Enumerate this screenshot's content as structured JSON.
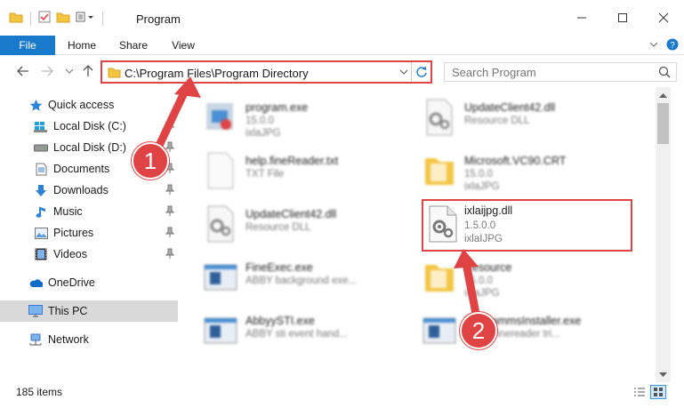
{
  "window": {
    "title": "Program"
  },
  "ribbon": {
    "file": "File",
    "home": "Home",
    "share": "Share",
    "view": "View"
  },
  "address": {
    "path": "C:\\Program Files\\Program Directory"
  },
  "search": {
    "placeholder": "Search Program"
  },
  "nav": {
    "quick_access": "Quick access",
    "local_c": "Local Disk (C:)",
    "local_d": "Local Disk (D:)",
    "documents": "Documents",
    "downloads": "Downloads",
    "music": "Music",
    "pictures": "Pictures",
    "videos": "Videos",
    "onedrive": "OneDrive",
    "this_pc": "This PC",
    "network": "Network"
  },
  "files": [
    {
      "name": "program.exe",
      "line2": "15.0.0",
      "line3": "ixlaJPG"
    },
    {
      "name": "UpdateClient42.dll",
      "line2": "Resource DLL",
      "line3": ""
    },
    {
      "name": "help.fineReader.txt",
      "line2": "TXT File",
      "line3": ""
    },
    {
      "name": "Microsoft.VC90.CRT",
      "line2": "15.0.0",
      "line3": "ixlaJPG"
    },
    {
      "name": "UpdateClient42.dll",
      "line2": "Resource DLL",
      "line3": ""
    },
    {
      "name": "FineExec.exe",
      "line2": "ABBY background exe...",
      "line3": ""
    },
    {
      "name": "Resource",
      "line2": "15.0.0",
      "line3": "ixlaJPG"
    },
    {
      "name": "AbbyySTI.exe",
      "line2": "ABBY sti event hand...",
      "line3": ""
    },
    {
      "name": "ProgrammsInstaller.exe",
      "line2": "ABBY finereader tri...",
      "line3": ""
    }
  ],
  "highlighted_file": {
    "name": "ixlaijpg.dll",
    "line2": "1.5.0.0",
    "line3": "ixlaIJPG"
  },
  "status": {
    "count": "185 items"
  },
  "annotations": {
    "one": "1",
    "two": "2"
  },
  "colors": {
    "accent": "#1979ca",
    "annotation": "#e04343",
    "folder": "#f4c542"
  }
}
